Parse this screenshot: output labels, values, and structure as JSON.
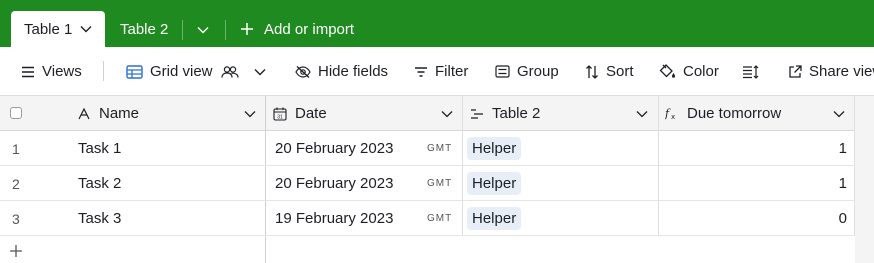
{
  "tabs": {
    "active_label": "Table 1",
    "second_label": "Table 2",
    "add_import_label": "Add or import"
  },
  "toolbar": {
    "views_label": "Views",
    "grid_view_label": "Grid view",
    "hide_fields_label": "Hide fields",
    "filter_label": "Filter",
    "group_label": "Group",
    "sort_label": "Sort",
    "color_label": "Color",
    "share_view_label": "Share view"
  },
  "columns": {
    "name": "Name",
    "date": "Date",
    "table2": "Table 2",
    "due": "Due tomorrow"
  },
  "rows": [
    {
      "num": "1",
      "name": "Task 1",
      "date": "20 February 2023",
      "tz": "GMT",
      "link": "Helper",
      "due": "1"
    },
    {
      "num": "2",
      "name": "Task 2",
      "date": "20 February 2023",
      "tz": "GMT",
      "link": "Helper",
      "due": "1"
    },
    {
      "num": "3",
      "name": "Task 3",
      "date": "19 February 2023",
      "tz": "GMT",
      "link": "Helper",
      "due": "0"
    }
  ],
  "colors": {
    "tabbar": "#1f8a1f",
    "header_bg": "#f4f4f4",
    "pill_bg": "#e8eef8"
  }
}
